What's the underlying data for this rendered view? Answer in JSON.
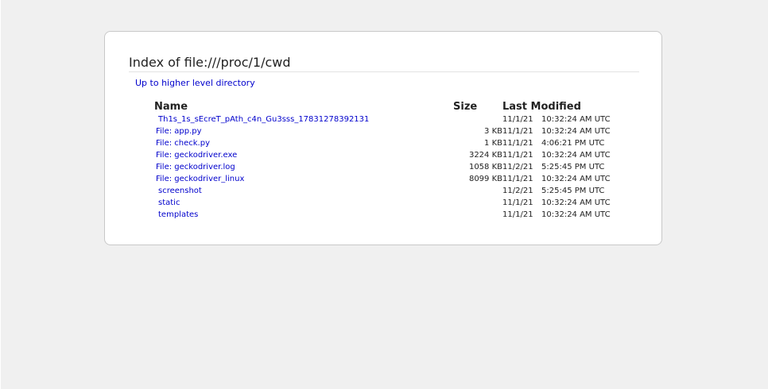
{
  "page": {
    "title": "Index of file:///proc/1/cwd",
    "up_link": "Up to higher level directory"
  },
  "columns": {
    "name": "Name",
    "size": "Size",
    "modified": "Last Modified"
  },
  "entries": [
    {
      "name": "Th1s_1s_sEcreT_pAth_c4n_Gu3sss_17831278392131",
      "type": "dir",
      "size": "",
      "date": "11/1/21",
      "time": "10:32:24 AM UTC"
    },
    {
      "name": "File: app.py",
      "type": "file",
      "size": "3 KB",
      "date": "11/1/21",
      "time": "10:32:24 AM UTC"
    },
    {
      "name": "File: check.py",
      "type": "file",
      "size": "1 KB",
      "date": "11/1/21",
      "time": "4:06:21 PM UTC"
    },
    {
      "name": "File: geckodriver.exe",
      "type": "file",
      "size": "3224 KB",
      "date": "11/1/21",
      "time": "10:32:24 AM UTC"
    },
    {
      "name": "File: geckodriver.log",
      "type": "file",
      "size": "1058 KB",
      "date": "11/2/21",
      "time": "5:25:45 PM UTC"
    },
    {
      "name": "File: geckodriver_linux",
      "type": "file",
      "size": "8099 KB",
      "date": "11/1/21",
      "time": "10:32:24 AM UTC"
    },
    {
      "name": "screenshot",
      "type": "dir",
      "size": "",
      "date": "11/2/21",
      "time": "5:25:45 PM UTC"
    },
    {
      "name": "static",
      "type": "dir",
      "size": "",
      "date": "11/1/21",
      "time": "10:32:24 AM UTC"
    },
    {
      "name": "templates",
      "type": "dir",
      "size": "",
      "date": "11/1/21",
      "time": "10:32:24 AM UTC"
    }
  ],
  "colors": {
    "link": "#0000cc",
    "background": "#f0f0f0",
    "panel": "#ffffff"
  }
}
